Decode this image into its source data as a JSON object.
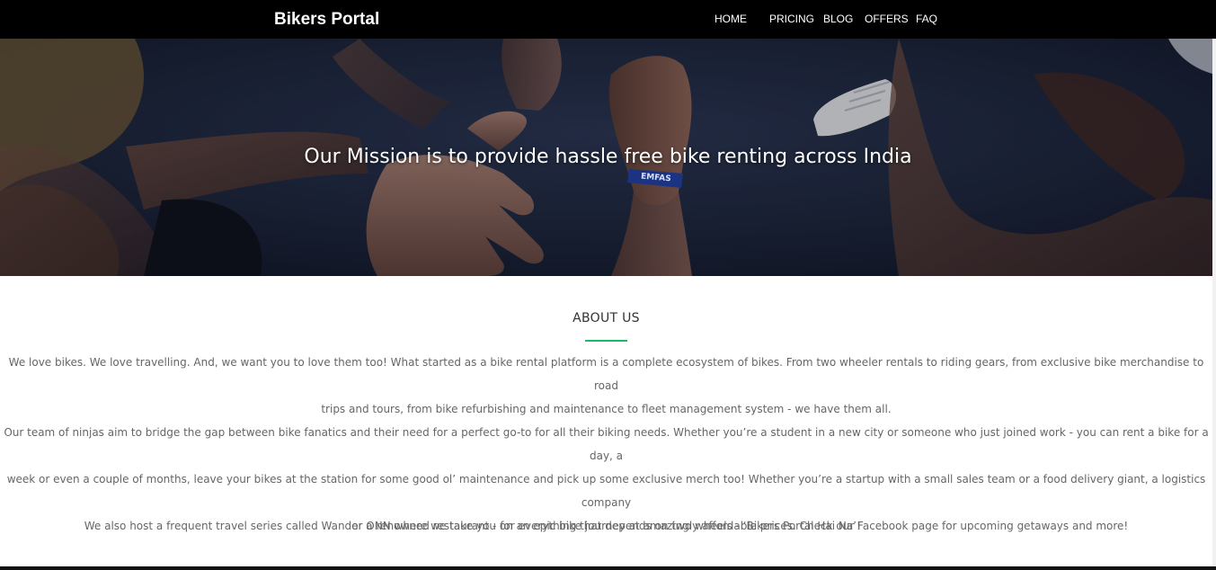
{
  "navbar": {
    "brand": "Bikers Portal",
    "links": [
      {
        "label": "HOME"
      },
      {
        "label": "PRICING"
      },
      {
        "label": "BLOG"
      },
      {
        "label": "OFFERS"
      },
      {
        "label": "FAQ"
      }
    ]
  },
  "hero": {
    "headline": "Our Mission is to provide hassle free bike renting across India",
    "wristband_text": "EMFAS"
  },
  "about": {
    "title": "ABOUT US",
    "accent_color": "#1aba6b",
    "paragraphs": [
      {
        "lines": [
          "We love bikes. We love travelling. And, we want you to love them too! What started as a bike rental platform is a complete ecosystem of bikes. From two wheeler rentals to riding gears, from exclusive bike merchandise to road",
          "trips and tours, from bike refurbishing and maintenance to fleet management system - we have them all."
        ]
      },
      {
        "lines": [
          "Our team of ninjas aim to bridge the gap between bike fanatics and their need for a perfect go-to for all their biking needs. Whether you’re a student in a new city or someone who just joined work - you can rent a bike for a day, a",
          "week or even a couple of months, leave your bikes at the station for some good ol’ maintenance and pick up some exclusive merch too! Whether you’re a startup with a small sales team or a food delivery giant, a logistics company",
          "or a renowned restaurant - for everything that depends on two wheels - ‘Bikers Portal Hai Na’!"
        ]
      },
      {
        "lines": [
          "We also host a frequent travel series called Wander ONN where we take you on an epic bike journey at amazingly affordable prices. Check our Facebook page for upcoming getaways and more!"
        ]
      }
    ]
  }
}
